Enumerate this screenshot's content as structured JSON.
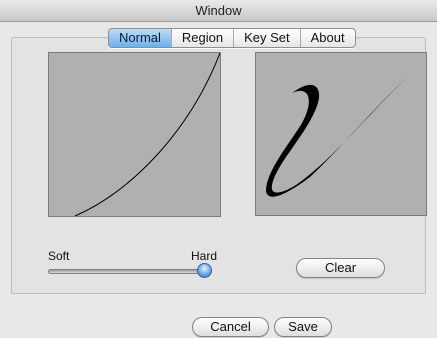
{
  "window": {
    "title": "Window"
  },
  "tabs": [
    {
      "label": "Normal",
      "selected": true
    },
    {
      "label": "Region",
      "selected": false
    },
    {
      "label": "Key Set",
      "selected": false
    },
    {
      "label": "About",
      "selected": false
    }
  ],
  "slider": {
    "min_label": "Soft",
    "max_label": "Hard",
    "value": 1.0
  },
  "buttons": {
    "clear": "Clear",
    "cancel": "Cancel",
    "save": "Save"
  },
  "colors": {
    "canvas_background": "#b0b0b0",
    "selected_tab": "#6fb0ea",
    "stroke": "#000000"
  }
}
